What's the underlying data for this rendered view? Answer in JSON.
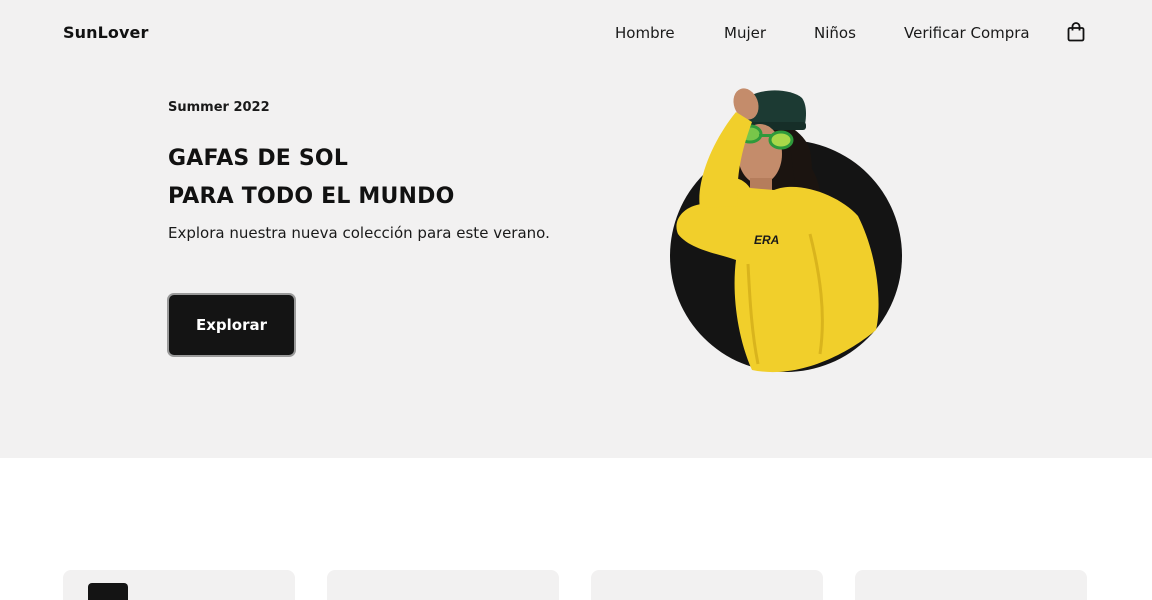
{
  "brand": "SunLover",
  "nav": {
    "items": [
      {
        "label": "Hombre"
      },
      {
        "label": "Mujer"
      },
      {
        "label": "Niños"
      },
      {
        "label": "Verificar Compra"
      }
    ],
    "cart_icon": "shopping-bag-icon"
  },
  "hero": {
    "season": "Summer 2022",
    "headline_line1": "GAFAS DE SOL",
    "headline_line2": "PARA TODO EL MUNDO",
    "subtitle": "Explora nuestra nueva colección para este verano.",
    "button_label": "Explorar",
    "image": "woman-in-yellow-sweatshirt-with-sunglasses"
  },
  "colors": {
    "hero_background": "#f2f1f1",
    "button_background": "#141414",
    "accent_yellow": "#f1cf2b"
  },
  "feature_cards": [
    {
      "icon": "feature-icon"
    },
    {},
    {},
    {}
  ]
}
